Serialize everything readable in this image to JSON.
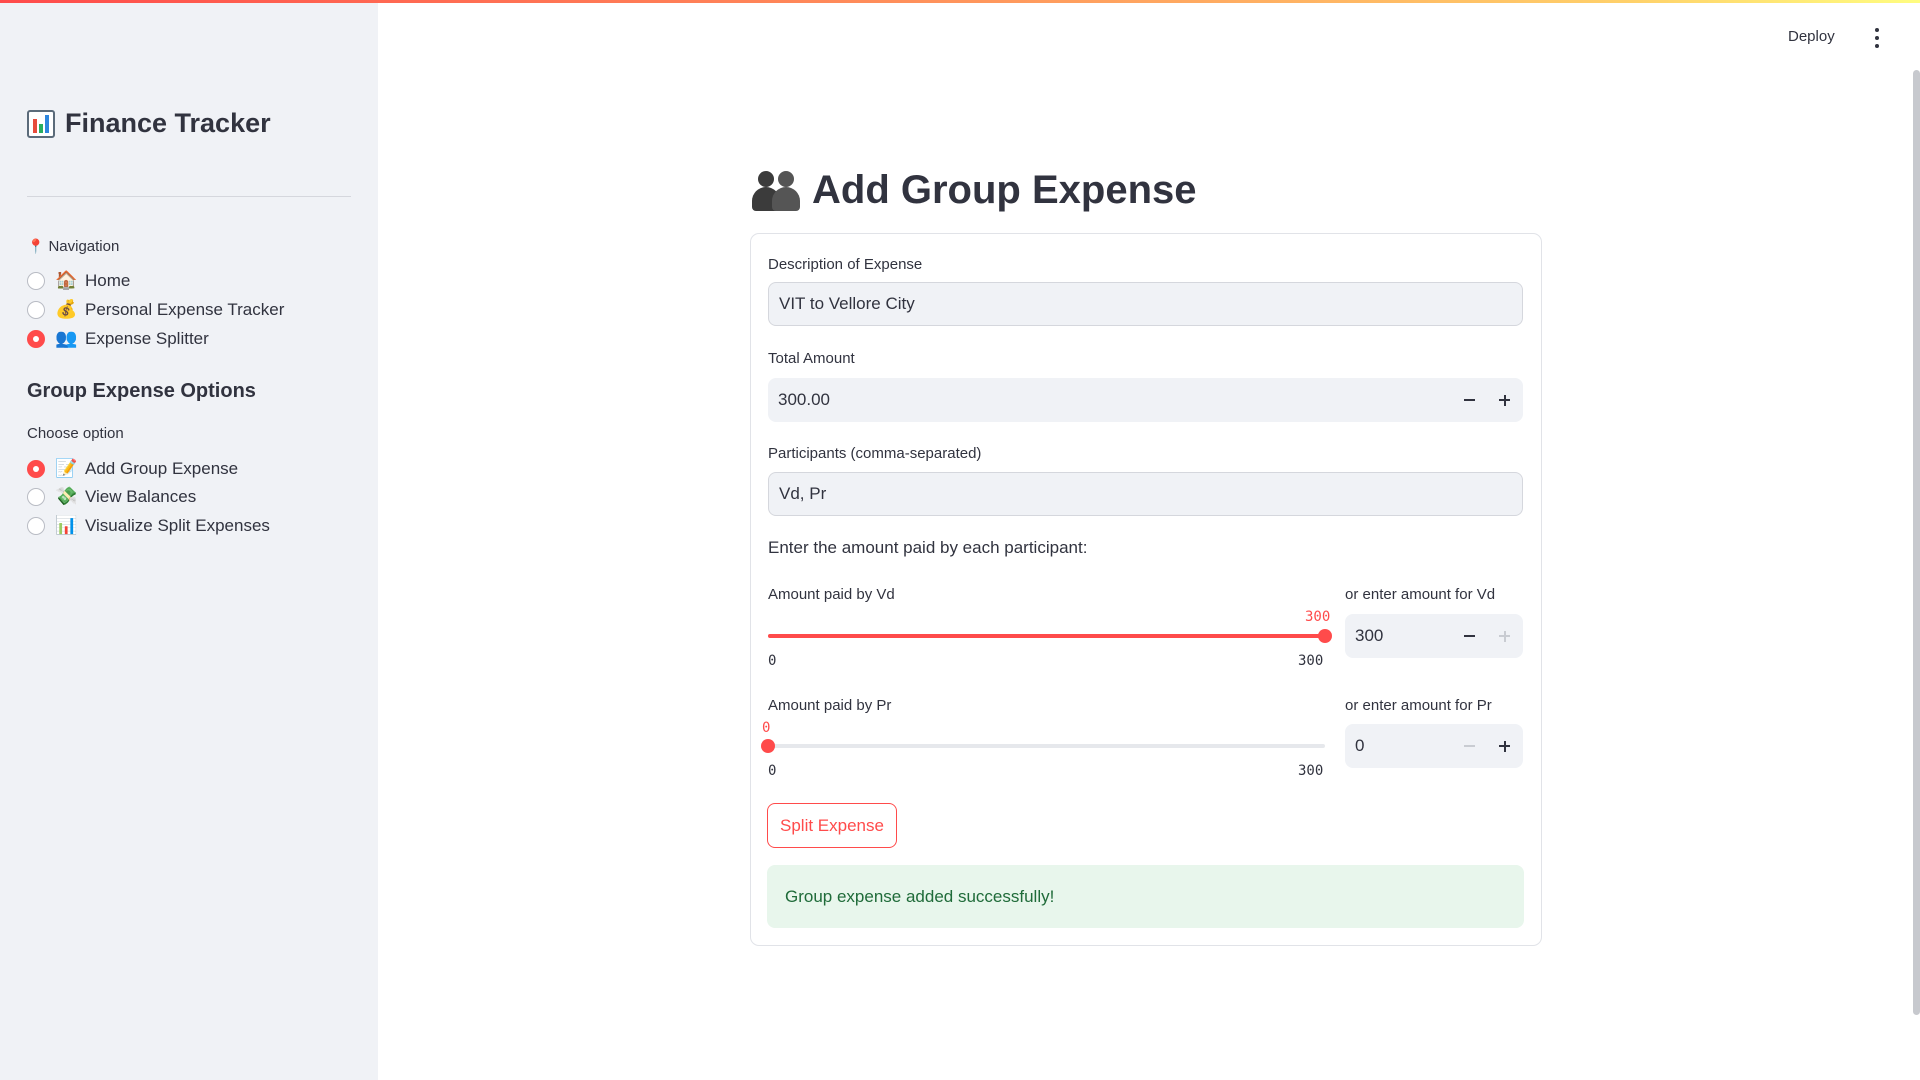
{
  "sidebar": {
    "app_title": "Finance Tracker",
    "nav_label": "Navigation",
    "nav_items": [
      {
        "icon": "🏠",
        "label": "Home",
        "selected": false
      },
      {
        "icon": "💰",
        "label": "Personal Expense Tracker",
        "selected": false
      },
      {
        "icon": "👥",
        "label": "Expense Splitter",
        "selected": true
      }
    ],
    "group_heading": "Group Expense Options",
    "option_label": "Choose option",
    "option_items": [
      {
        "icon": "📝",
        "label": "Add Group Expense",
        "selected": true
      },
      {
        "icon": "💸",
        "label": "View Balances",
        "selected": false
      },
      {
        "icon": "📊",
        "label": "Visualize Split Expenses",
        "selected": false
      }
    ]
  },
  "header": {
    "deploy_label": "Deploy"
  },
  "main": {
    "title": "Add Group Expense",
    "description": {
      "label": "Description of Expense",
      "value": "VIT to Vellore City"
    },
    "total_amount": {
      "label": "Total Amount",
      "value": "300.00"
    },
    "participants": {
      "label": "Participants (comma-separated)",
      "value": "Vd, Pr"
    },
    "instruction": "Enter the amount paid by each participant:",
    "payers": [
      {
        "slider_label": "Amount paid by Vd",
        "value": 300,
        "min": 0,
        "max": 300,
        "value_text": "300",
        "min_text": "0",
        "max_text": "300",
        "input_label": "or enter amount for Vd",
        "input_value": "300"
      },
      {
        "slider_label": "Amount paid by Pr",
        "value": 0,
        "min": 0,
        "max": 300,
        "value_text": "0",
        "min_text": "0",
        "max_text": "300",
        "input_label": "or enter amount for Pr",
        "input_value": "0"
      }
    ],
    "split_button": "Split Expense",
    "success_message": "Group expense added successfully!"
  },
  "colors": {
    "accent": "#ff4b4b",
    "sidebar_bg": "#f0f2f6",
    "success_bg": "#e8f6ec",
    "success_text": "#1f6b39"
  }
}
